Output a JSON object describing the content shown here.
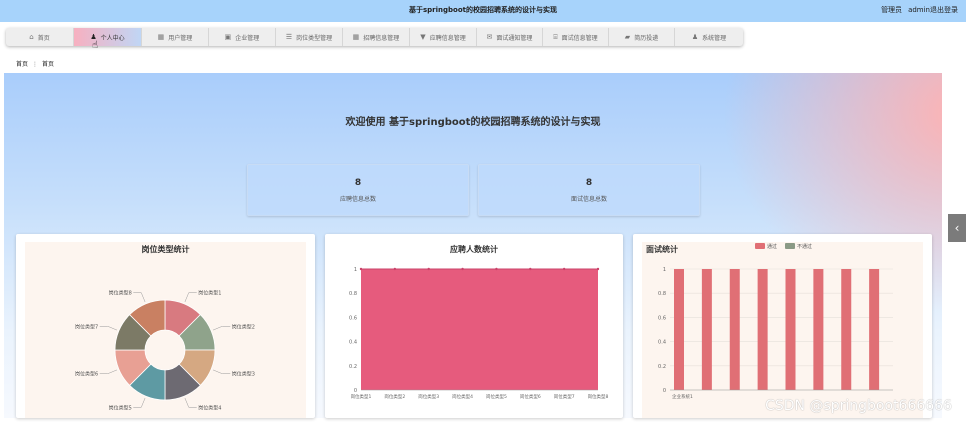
{
  "header": {
    "title": "基于springboot的校园招聘系统的设计与实现",
    "role": "管理员",
    "username": "admin",
    "logout": "退出登录"
  },
  "nav": {
    "tabs": [
      {
        "label": "首页",
        "icon": "home-icon",
        "glyph": "⌂",
        "width": 68
      },
      {
        "label": "个人中心",
        "icon": "person-icon",
        "glyph": "♟",
        "width": 68,
        "active": true
      },
      {
        "label": "用户管理",
        "icon": "grid-icon",
        "glyph": "▦",
        "width": 67
      },
      {
        "label": "企业管理",
        "icon": "building-icon",
        "glyph": "▣",
        "width": 67
      },
      {
        "label": "岗位类型管理",
        "icon": "list-icon",
        "glyph": "☰",
        "width": 67
      },
      {
        "label": "招聘信息管理",
        "icon": "grid-icon",
        "glyph": "▦",
        "width": 67
      },
      {
        "label": "应聘信息管理",
        "icon": "funnel-icon",
        "glyph": "▼",
        "width": 67
      },
      {
        "label": "面试通知管理",
        "icon": "message-icon",
        "glyph": "✉",
        "width": 66
      },
      {
        "label": "面试信息管理",
        "icon": "bank-icon",
        "glyph": "⌸",
        "width": 66
      },
      {
        "label": "简历投递",
        "icon": "briefcase-icon",
        "glyph": "▰",
        "width": 66
      },
      {
        "label": "系统管理",
        "icon": "user-icon",
        "glyph": "♟",
        "width": 68
      }
    ]
  },
  "breadcrumb": {
    "home": "首页",
    "sep": "⋮",
    "current": "首页"
  },
  "welcome": "欢迎使用 基于springboot的校园招聘系统的设计与实现",
  "stats": [
    {
      "value": "8",
      "label": "应聘信息总数"
    },
    {
      "value": "8",
      "label": "面试信息总数"
    }
  ],
  "side_toggle": "‹",
  "watermark": "CSDN @springboot666666",
  "colors": {
    "accent": "#a7d3fb",
    "line_fill": "#e65b7d",
    "bar_pass": "#e06f75",
    "bar_fail": "#8a9a86",
    "chart_bg": "#fdf5ef"
  },
  "chart_data": [
    {
      "type": "pie",
      "title": "岗位类型统计",
      "donut": true,
      "categories": [
        "岗位类型1",
        "岗位类型2",
        "岗位类型3",
        "岗位类型4",
        "岗位类型5",
        "岗位类型6",
        "岗位类型7",
        "岗位类型8"
      ],
      "values": [
        1,
        1,
        1,
        1,
        1,
        1,
        1,
        1
      ],
      "colors": [
        "#d87a80",
        "#8fa38b",
        "#d5a882",
        "#6d6a72",
        "#5e9aa3",
        "#e8a094",
        "#7c7a66",
        "#c98062"
      ]
    },
    {
      "type": "area",
      "title": "应聘人数统计",
      "categories": [
        "岗位类型1",
        "岗位类型2",
        "岗位类型3",
        "岗位类型4",
        "岗位类型5",
        "岗位类型6",
        "岗位类型7",
        "岗位类型8"
      ],
      "values": [
        1,
        1,
        1,
        1,
        1,
        1,
        1,
        1
      ],
      "ylim": [
        0,
        1
      ],
      "yticks": [
        "0",
        "0.2",
        "0.4",
        "0.6",
        "0.8",
        "1"
      ]
    },
    {
      "type": "bar",
      "title": "面试统计",
      "categories": [
        "企业系统1",
        "",
        "",
        "",
        "",
        "",
        "",
        ""
      ],
      "series": [
        {
          "name": "通过",
          "values": [
            1,
            1,
            1,
            1,
            1,
            1,
            1,
            1
          ]
        },
        {
          "name": "不通过",
          "values": [
            0,
            0,
            0,
            0,
            0,
            0,
            0,
            0
          ]
        }
      ],
      "ylim": [
        0,
        1
      ],
      "yticks": [
        "0",
        "0.2",
        "0.4",
        "0.6",
        "0.8",
        "1"
      ],
      "legend": "top"
    }
  ]
}
